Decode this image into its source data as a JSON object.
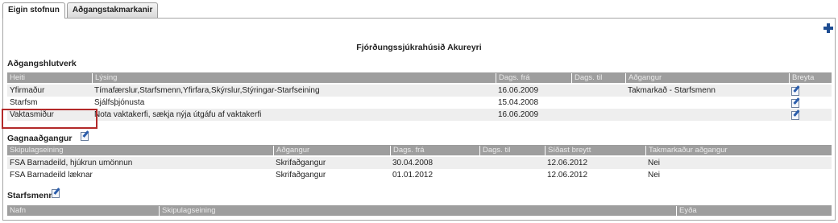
{
  "tabs": [
    {
      "label": "Eigin stofnun"
    },
    {
      "label": "Aðgangstakmarkanir"
    }
  ],
  "organization": "Fjórðungssjúkrahúsið Akureyri",
  "roles": {
    "title": "Aðgangshlutverk",
    "columns": [
      "Heiti",
      "Lýsing",
      "Dags. frá",
      "Dags. til",
      "Aðgangur",
      "Breyta"
    ],
    "rows": [
      {
        "name": "Yfirmaður",
        "description": "Tímafærslur,Starfsmenn,Yfirfara,Skýrslur,Stýringar-Starfseining",
        "from": "16.06.2009",
        "to": "",
        "access": "Takmarkað - Starfsmenn"
      },
      {
        "name": "Starfsm",
        "description": "Sjálfsþjónusta",
        "from": "15.04.2008",
        "to": "",
        "access": ""
      },
      {
        "name": "Vaktasmiður",
        "description": "Nota vaktakerfi, sækja nýja útgáfu af vaktakerfi",
        "from": "16.06.2009",
        "to": "",
        "access": ""
      }
    ]
  },
  "data_access": {
    "title": "Gagnaaðgangur",
    "columns": [
      "Skipulagseining",
      "Aðgangur",
      "Dags. frá",
      "Dags. til",
      "Síðast breytt",
      "Takmarkaður aðgangur"
    ],
    "rows": [
      {
        "unit": "FSA Barnadeild, hjúkrun umönnun",
        "access": "Skrifaðgangur",
        "from": "30.04.2008",
        "to": "",
        "changed": "12.06.2012",
        "restricted": "Nei"
      },
      {
        "unit": "FSA Barnadeild læknar",
        "access": "Skrifaðgangur",
        "from": "01.01.2012",
        "to": "",
        "changed": "12.06.2012",
        "restricted": "Nei"
      }
    ]
  },
  "employees": {
    "title": "Starfsmenn",
    "columns": [
      "Nafn",
      "Skipulagseining",
      "Eyða"
    ]
  },
  "icons": {
    "add": "plus-icon",
    "edit": "edit-icon"
  },
  "colors": {
    "header": "#9e9e9e",
    "highlight": "#b32a2a",
    "add_icon": "#1e4d92"
  }
}
